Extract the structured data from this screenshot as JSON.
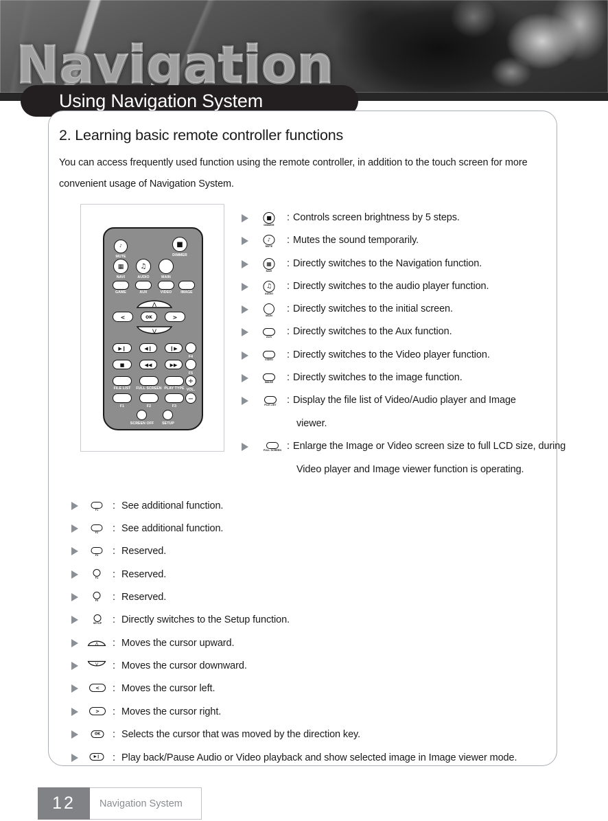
{
  "banner": {
    "wordmark": "Navigation",
    "title_pill": "Using Navigation System"
  },
  "section": {
    "heading": "2. Learning basic remote controller functions",
    "intro": "You can access frequently used function using the remote controller, in addition to the touch screen for more convenient usage of Navigation System."
  },
  "remote": {
    "alt": "remote-controller-diagram",
    "buttons": [
      {
        "label": "MUTE",
        "glyph": "mute"
      },
      {
        "label": "DIMMER",
        "glyph": "dimmer"
      },
      {
        "label": "NAVI",
        "glyph": "navi"
      },
      {
        "label": "AUDIO",
        "glyph": "audio"
      },
      {
        "label": "MAIN",
        "glyph": ""
      },
      {
        "label": "GAME",
        "glyph": ""
      },
      {
        "label": "AUX",
        "glyph": ""
      },
      {
        "label": "VIDEO",
        "glyph": ""
      },
      {
        "label": "IMAGE",
        "glyph": ""
      },
      {
        "label": "OK",
        "glyph": "OK"
      },
      {
        "label": "FILE LIST",
        "glyph": ""
      },
      {
        "label": "FULL SCREEN",
        "glyph": ""
      },
      {
        "label": "PLAY TYPE",
        "glyph": ""
      },
      {
        "label": "F1",
        "glyph": ""
      },
      {
        "label": "F2",
        "glyph": ""
      },
      {
        "label": "F3",
        "glyph": ""
      },
      {
        "label": "F4",
        "glyph": ""
      },
      {
        "label": "F5",
        "glyph": ""
      },
      {
        "label": "VOL.",
        "glyph": "+ -"
      },
      {
        "label": "SCREEN OFF",
        "glyph": ""
      },
      {
        "label": "SETUP",
        "glyph": ""
      }
    ]
  },
  "list_right": [
    {
      "key": "DIMMER",
      "colon": ":",
      "text": "Controls screen brightness by 5 steps."
    },
    {
      "key": "MUTE",
      "colon": ":",
      "text": "Mutes the sound temporarily."
    },
    {
      "key": "NAVI",
      "colon": ":",
      "text": "Directly switches to the Navigation function."
    },
    {
      "key": "AUDIO",
      "colon": ":",
      "text": "Directly switches to the audio player function."
    },
    {
      "key": "MAIN",
      "colon": ":",
      "text": "Directly switches to the initial screen."
    },
    {
      "key": "AUX",
      "colon": ":",
      "text": "Directly switches to the Aux function."
    },
    {
      "key": "VIDEO",
      "colon": ":",
      "text": "Directly switches to the Video player function."
    },
    {
      "key": "IMAGE",
      "colon": ":",
      "text": "Directly switches to the image function."
    },
    {
      "key": "FILE LIST",
      "colon": ":",
      "text": "Display the file list of Video/Audio player and Image",
      "text2": "viewer."
    },
    {
      "key": "FULL SCREEN",
      "colon": ":",
      "text": "Enlarge the Image or Video screen size to full LCD size, during",
      "text2": "Video player and Image viewer function is operating."
    }
  ],
  "list_bottom": [
    {
      "key": "F1",
      "colon": ":",
      "text": "See additional function."
    },
    {
      "key": "F2",
      "colon": ":",
      "text": "See additional function."
    },
    {
      "key": "F3",
      "colon": ":",
      "text": "Reserved."
    },
    {
      "key": "F4",
      "colon": ":",
      "text": "Reserved."
    },
    {
      "key": "F5",
      "colon": ":",
      "text": "Reserved."
    },
    {
      "key": "SETUP",
      "colon": ":",
      "text": "Directly switches to the Setup function."
    },
    {
      "key": "UP",
      "colon": ":",
      "text": "Moves the cursor upward."
    },
    {
      "key": "DOWN",
      "colon": ":",
      "text": "Moves the cursor downward."
    },
    {
      "key": "LEFT",
      "colon": ":",
      "text": "Moves the cursor left."
    },
    {
      "key": "RIGHT",
      "colon": ":",
      "text": "Moves the cursor right."
    },
    {
      "key": "OK",
      "colon": ":",
      "text": "Selects the cursor that was moved by the direction key."
    },
    {
      "key": "PLAY",
      "colon": ":",
      "text": "Play back/Pause Audio or Video playback and show selected image in Image viewer mode."
    }
  ],
  "footer": {
    "page_number": "12",
    "label": "Navigation System"
  },
  "colors": {
    "pill": "#231f20",
    "panel_border": "#a9aeb5",
    "remote_body": "#8d8d8d",
    "arrow": "#8b8f96",
    "footer_num_bg": "#808285",
    "footer_label_text": "#8a8d91"
  }
}
